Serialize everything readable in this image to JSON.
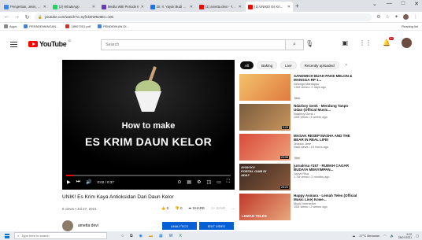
{
  "browser": {
    "tabs": [
      {
        "label": "Pengertian, Jenis, Dan",
        "color": "#4285f4",
        "active": false
      },
      {
        "label": "(2) WhatsApp",
        "color": "#25d366",
        "active": false
      },
      {
        "label": "Media WBI Periode II",
        "color": "#673ab7",
        "active": false
      },
      {
        "label": "Dr. Ir. Yayuk Budi Pras",
        "color": "#1a73e8",
        "active": false
      },
      {
        "label": "(1) ametta devi - YouT",
        "color": "#ff0000",
        "active": false
      },
      {
        "label": "(1) UNIKE! Es Krim Kay",
        "color": "#ff0000",
        "active": true
      }
    ],
    "new_tab": "+",
    "window_controls": [
      "⌄",
      "—",
      "□",
      "✕"
    ],
    "url": "youtube.com/watch?v=nyfCbEW6v8Ec=10s",
    "bookmarks": [
      "Apps",
      "PERADEMANGAN...",
      "18907001.pdf",
      "PENDIDIKAN DI..."
    ],
    "reading_list": "Reading list"
  },
  "youtube": {
    "logo_text": "YouTube",
    "country_code": "ID",
    "search_placeholder": "Search",
    "notifications_badge": "9+"
  },
  "player": {
    "overlay_line1": "How to make",
    "overlay_line2": "ES KRIM DAUN KELOR",
    "time": "0:02 / 0:37",
    "progress": 0.05
  },
  "video": {
    "title": "UNIK! Es Krim Kaya Antioksidan Dari Daun Kelor",
    "views_date": "6 views • Jul 27, 2021",
    "likes": "0",
    "dislikes": "0",
    "share": "SHARE",
    "save": "SAVE",
    "more": "...",
    "channel_name": "ametta devi",
    "analytics": "ANALYTICS",
    "edit_video": "EDIT VIDEO"
  },
  "chips": [
    "All",
    "Baking",
    "Live",
    "Recently uploaded"
  ],
  "recommendations": [
    {
      "title": "SANDWICH BUAH PAKE MELON & MANGGA RP 1...",
      "channel": "Nihongo Mantappu",
      "meta": "1.6M views • 2 days ago",
      "badge": "New",
      "duration": ""
    },
    {
      "title": "Ndarboy Genk - Mendung Tanpo Udan (Official Music...",
      "channel": "Ndarboy Genk ♪",
      "meta": "10M views • 4 weeks ago",
      "badge": "",
      "duration": "5:29"
    },
    {
      "title": "MASAK RESEP MASHA AND THE BEAR IN REAL LIFE!",
      "channel": "Jessica Jane",
      "meta": "Nadi views • 19 hours ago",
      "badge": "New",
      "duration": "25:55"
    },
    {
      "title": "jurnalrisa #157 - RUMAH CAGAR BUDAYA MENYIMPAN...",
      "channel": "Jurnal Risa",
      "meta": "1.7M views • 2 months ago",
      "badge": "",
      "duration": "28:20"
    },
    {
      "title": "Happy Asmara - Lemah Teles (Official Music Live) Kowe...",
      "channel": "Music Interactive",
      "meta": "10M views • 2 weeks ago",
      "badge": "",
      "duration": ""
    }
  ],
  "thumb_texts": [
    "",
    "",
    "",
    "AYAH KU PORTAL GAIB DI ADA?",
    "LEMAH TELES"
  ],
  "taskbar": {
    "search_placeholder": "Type here to search",
    "weather": "27°C Berawan",
    "time": "9:02",
    "date": "28/07/2021"
  },
  "colors": {
    "youtube_red": "#ff0000",
    "player_bg": "#000000",
    "subscribe_blue": "#065fd4"
  }
}
